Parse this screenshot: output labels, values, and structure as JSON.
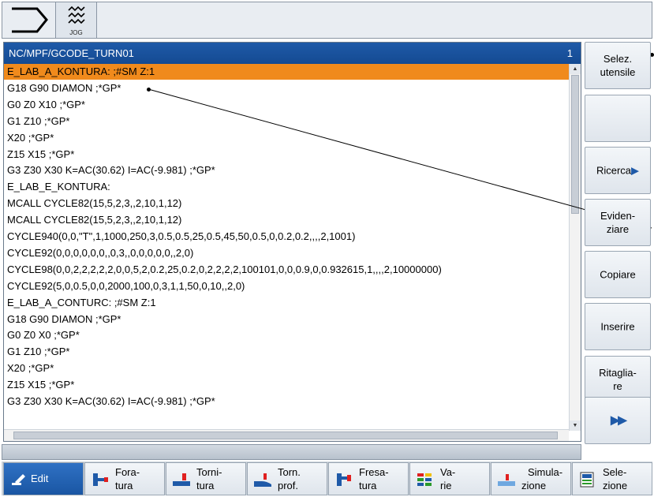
{
  "topbar": {
    "mode_label": "JOG"
  },
  "editor": {
    "path": "NC/MPF/GCODE_TURN01",
    "line_number": "1",
    "lines": [
      "E_LAB_A_KONTURA: ;#SM Z:1",
      "G18 G90 DIAMON ;*GP*",
      "G0 Z0 X10 ;*GP*",
      "G1 Z10 ;*GP*",
      "X20 ;*GP*",
      "Z15 X15 ;*GP*",
      "G3 Z30 X30 K=AC(30.62) I=AC(-9.981) ;*GP*",
      "E_LAB_E_KONTURA:",
      "MCALL CYCLE82(15,5,2,3,,2,10,1,12)",
      "MCALL CYCLE82(15,5,2,3,,2,10,1,12)",
      "CYCLE940(0,0,\"T\",1,1000,250,3,0.5,0.5,25,0.5,45,50,0.5,0,0.2,0.2,,,,2,1001)",
      "CYCLE92(0,0,0,0,0,0,,0,3,,0,0,0,0,0,,2,0)",
      "CYCLE98(0,0,2,2,2,2,2,0,0,5,2,0.2,25,0.2,0,2,2,2,2,100101,0,0,0.9,0,0.932615,1,,,,2,10000000)",
      "CYCLE92(5,0,0.5,0,0,2000,100,0,3,1,1,50,0,10,,2,0)",
      "E_LAB_A_CONTURC: ;#SM Z:1",
      "G18 G90 DIAMON ;*GP*",
      "G0 Z0 X0 ;*GP*",
      "G1 Z10 ;*GP*",
      "X20 ;*GP*",
      "Z15 X15 ;*GP*",
      "G3 Z30 X30 K=AC(30.62) I=AC(-9.981) ;*GP*"
    ],
    "active_line_index": 0
  },
  "softkeys": {
    "select_tool": "Selez.\nutensile",
    "empty": "",
    "search": "Ricerca",
    "highlight": "Eviden-\nziare",
    "copy": "Copiare",
    "insert": "Inserire",
    "cut": "Ritaglia-\nre",
    "more": "▶▶"
  },
  "hsoftkeys": {
    "edit": "Edit",
    "drilling_1": "Fora-",
    "drilling_2": "tura",
    "turning_1": "Torni-",
    "turning_2": "tura",
    "turn_prof_1": "Torn.",
    "turn_prof_2": "prof.",
    "milling_1": "Fresa-",
    "milling_2": "tura",
    "misc_1": "Va-",
    "misc_2": "rie",
    "simulation_1": "Simula-",
    "simulation_2": "zione",
    "select_1": "Sele-",
    "select_2": "zione"
  },
  "colors": {
    "header": "#1f5aa8",
    "active_line": "#f08a1c",
    "active_key": "#2f71c4"
  }
}
